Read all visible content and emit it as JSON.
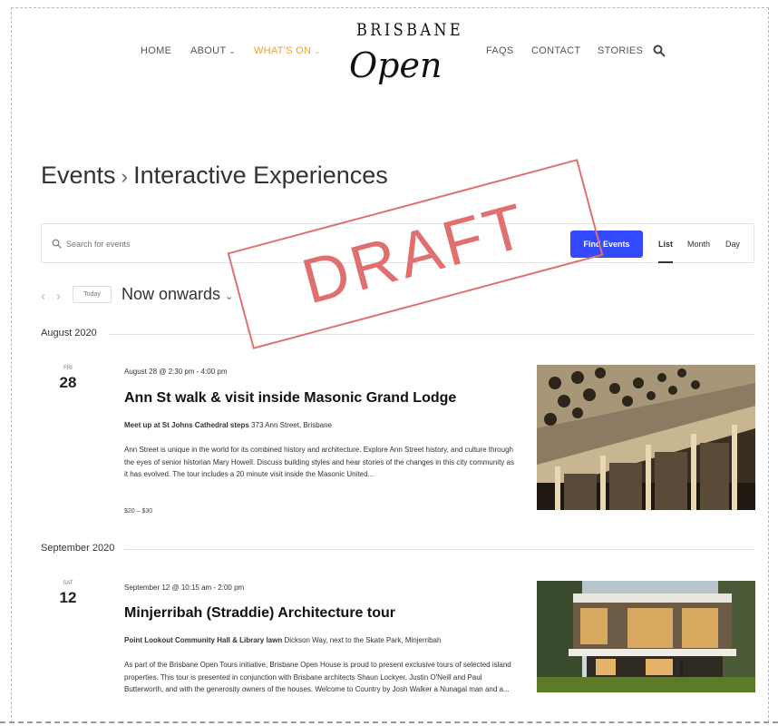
{
  "nav": {
    "home": "HOME",
    "about": "ABOUT",
    "whats_on": "WHAT'S ON",
    "faqs": "FAQS",
    "contact": "CONTACT",
    "stories": "STORIES"
  },
  "logo": {
    "top": "BRISBANE",
    "bottom": "Open"
  },
  "page": {
    "crumb": "Events",
    "title": "Interactive Experiences"
  },
  "search": {
    "placeholder": "Search for events",
    "button": "Find Events"
  },
  "views": {
    "list": "List",
    "month": "Month",
    "day": "Day"
  },
  "calendar": {
    "today": "Today",
    "range": "Now onwards"
  },
  "months": [
    "August 2020",
    "September 2020"
  ],
  "events": [
    {
      "day_abbr": "FRI",
      "day_num": "28",
      "datetime": "August 28 @ 2:30 pm - 4:00 pm",
      "title": "Ann St walk & visit inside Masonic Grand Lodge",
      "venue_name": "Meet up at St Johns Cathedral steps",
      "venue_address": "373 Ann Street, Brisbane",
      "description": "Ann Street is unique in the world for its combined history and architecture. Explore Ann Street history, and culture through the eyes of senior historian Mary Howell. Discuss building styles and hear stories of the changes in this city community as it has evolved. The tour includes a 20 minute visit inside the Masonic United...",
      "price": "$20 – $30"
    },
    {
      "day_abbr": "SAT",
      "day_num": "12",
      "datetime": "September 12 @ 10:15 am - 2:00 pm",
      "title": "Minjerribah (Straddie) Architecture tour",
      "venue_name": "Point Lookout Community Hall & Library lawn",
      "venue_address": "Dickson Way, next to the Skate Park, Minjerribah",
      "description": "As part of the Brisbane Open Tours initiative, Brisbane Open House is proud to present exclusive tours of selected island properties. This tour is presented in conjunction with Brisbane architects Shaun Lockyer, Justin O'Neill and Paul Butterworth, and with the generosity owners of the houses. Welcome to Country by Josh Walker a Nunagal man and a..."
    }
  ],
  "stamp": "DRAFT",
  "colors": {
    "accent": "#f0a030",
    "button": "#334aff",
    "stamp": "#e07070"
  }
}
